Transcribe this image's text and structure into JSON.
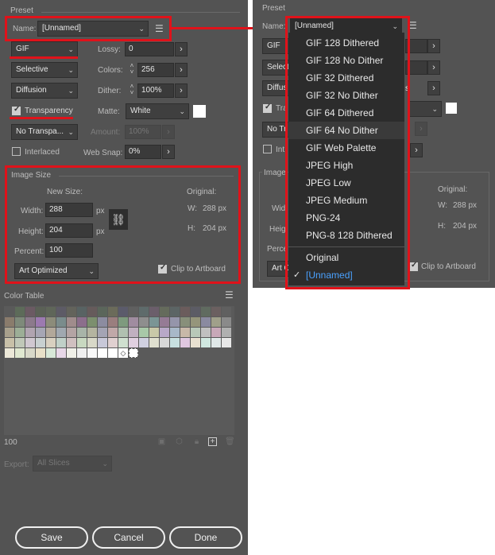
{
  "left": {
    "preset_label": "Preset",
    "name_label": "Name:",
    "name_value": "[Unnamed]",
    "format_value": "GIF",
    "lossy_label": "Lossy:",
    "lossy_value": "0",
    "reduction_value": "Selective",
    "colors_label": "Colors:",
    "colors_value": "256",
    "dither_algo_value": "Diffusion",
    "dither_label": "Dither:",
    "dither_value": "100%",
    "transparency_label": "Transparency",
    "matte_label": "Matte:",
    "matte_value": "White",
    "transparency_dither_value": "No Transpa...",
    "amount_label": "Amount:",
    "amount_value": "100%",
    "interlaced_label": "Interlaced",
    "websnap_label": "Web Snap:",
    "websnap_value": "0%",
    "image_size_title": "Image Size",
    "new_size_label": "New Size:",
    "original_label": "Original:",
    "width_label": "Width:",
    "width_value": "288",
    "height_label": "Height:",
    "height_value": "204",
    "px_unit": "px",
    "orig_w_label": "W:",
    "orig_w_value": "288 px",
    "orig_h_label": "H:",
    "orig_h_value": "204 px",
    "percent_label": "Percent:",
    "percent_value": "100",
    "quality_value": "Art Optimized",
    "clip_label": "Clip to Artboard",
    "color_table_title": "Color Table",
    "color_count": "100",
    "export_label": "Export:",
    "export_value": "All Slices",
    "save_label": "Save",
    "cancel_label": "Cancel",
    "done_label": "Done"
  },
  "right": {
    "preset_label": "Preset",
    "name_label": "Name:",
    "name_value": "[Unnamed]",
    "format_value": "GIF",
    "reduction_value": "Selecti",
    "dither_algo_value": "Diffus",
    "transparency_label": "Tra",
    "transparency_dither_value": "No Tr",
    "interlaced_label": "Int",
    "image_size_title": "Image",
    "width_label": "Wid",
    "height_label": "Heig",
    "percent_label": "Perce",
    "quality_value": "Art O",
    "original_label": "Original:",
    "orig_w_label": "W:",
    "orig_w_value": "288 px",
    "orig_h_label": "H:",
    "orig_h_value": "204 px",
    "clip_label": "Clip to Artboard"
  },
  "dropdown": {
    "items": [
      "GIF 128 Dithered",
      "GIF 128 No Dither",
      "GIF 32 Dithered",
      "GIF 32 No Dither",
      "GIF 64 Dithered",
      "GIF 64 No Dither",
      "GIF Web Palette",
      "JPEG High",
      "JPEG Low",
      "JPEG Medium",
      "PNG-24",
      "PNG-8 128 Dithered"
    ],
    "highlighted_index": 5,
    "extra_items": [
      "Original",
      "[Unnamed]"
    ],
    "selected_extra_index": 1,
    "check_mark": "✓"
  },
  "colors": {
    "annotation_red": "#e0121a",
    "panel_bg": "#535353",
    "selected_blue": "#4aa1ff",
    "swatch_rows": [
      [
        "#5a5a5a",
        "#5d6b59",
        "#6b5a63",
        "#5b6156",
        "#5f6659",
        "#5d5b66",
        "#63635b",
        "#586363",
        "#665b5b",
        "#5b665b",
        "#6b6b5a",
        "#5b5b6b",
        "#606060",
        "#5e6b6b",
        "#6b5e6b",
        "#656b5c",
        "#5c6565",
        "#6b5c5c",
        "#5c5c65",
        "#606b60",
        "#6b6060",
        "#606060"
      ],
      [
        "#8a7c6c",
        "#7e8a7a",
        "#8c7a8c",
        "#9c7ab0",
        "#8c8c7a",
        "#7a8c8c",
        "#a08c8c",
        "#8c6e8c",
        "#7c8f6e",
        "#8c8ca0",
        "#9a7e7e",
        "#7e9a7e",
        "#a08ca0",
        "#8e8e8e",
        "#7b9595",
        "#957b95",
        "#9595aa",
        "#888f7a",
        "#95957b",
        "#8a8aa0",
        "#a0a08a",
        "#8a8a8a"
      ],
      [
        "#a8a08c",
        "#9cae96",
        "#b0a4b0",
        "#a6a6b4",
        "#b2a89a",
        "#a0a8b0",
        "#b4a4a4",
        "#a8b4a8",
        "#b4b4a0",
        "#a4a4b4",
        "#c0a8a8",
        "#b0c0b0",
        "#c0b0c0",
        "#a8c8a8",
        "#c8c8a8",
        "#b8a8c8",
        "#a8b8c8",
        "#c8b8a8",
        "#b8c8b8",
        "#c0c0c0",
        "#c8a8b8",
        "#b0b0b0"
      ],
      [
        "#c8c0a8",
        "#c0c8b8",
        "#d0c8d0",
        "#c8d0d0",
        "#d8d0c0",
        "#c0d0c8",
        "#d0c0c0",
        "#c8d8c0",
        "#d8d8c8",
        "#c8c8d8",
        "#e0d0d0",
        "#d0e0d0",
        "#e0d0e0",
        "#d0d0e0",
        "#e0e0d0",
        "#d8d8d8",
        "#c8e0e0",
        "#e0c8e0",
        "#e8e0d0",
        "#d0e8e0",
        "#e0e8e8",
        "#e8e8e8"
      ],
      [
        "#ece8d8",
        "#e0e8d0",
        "#d8d8c8",
        "#e8e0c8",
        "#d8e8d8",
        "#e8d8e8",
        "#f0f0e8",
        "#f0f0f0",
        "#f8f8f8",
        "#ffffff",
        "#ffffff"
      ]
    ]
  }
}
